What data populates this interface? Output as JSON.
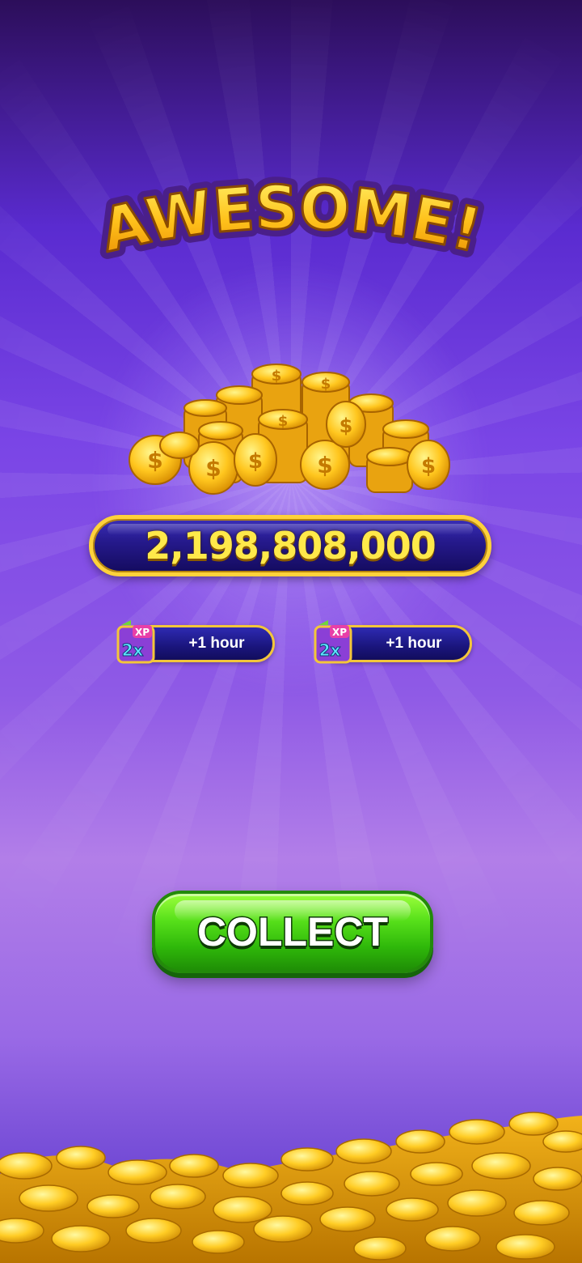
{
  "title": "AWESOME!",
  "reward": {
    "amount": "2,198,808,000"
  },
  "bonuses": [
    {
      "icon": "2x-xp-booster-icon",
      "badge": "2x",
      "badge_label": "XP",
      "label": "+1 hour"
    },
    {
      "icon": "2x-xp-booster-icon",
      "badge": "2x",
      "badge_label": "XP",
      "label": "+1 hour"
    }
  ],
  "collect_button": {
    "label": "COLLECT"
  },
  "colors": {
    "gold": "#ffd23a",
    "button_green": "#3cc912",
    "bar_navy": "#1a157c",
    "background_purple": "#7a45e6"
  }
}
